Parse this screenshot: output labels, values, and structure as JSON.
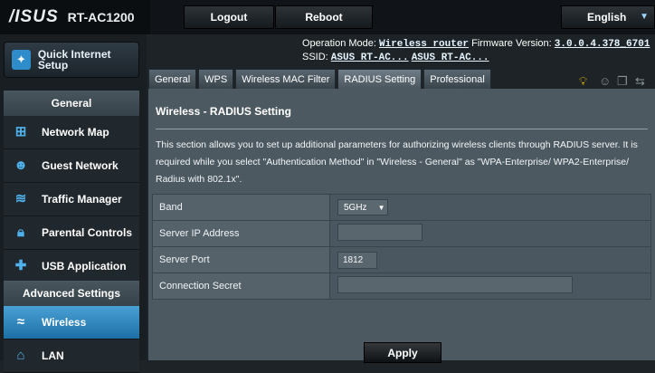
{
  "brand": {
    "logo": "/ISUS",
    "model": "RT-AC1200"
  },
  "header": {
    "logout": "Logout",
    "reboot": "Reboot",
    "language": "English"
  },
  "status": {
    "op_mode_label": "Operation Mode:",
    "op_mode_value": "Wireless router",
    "fw_label": "Firmware Version:",
    "fw_value": "3.0.0.4.378_6701",
    "ssid_label": "SSID:",
    "ssid_1": "ASUS RT-AC...",
    "ssid_2": "ASUS RT-AC..."
  },
  "sidebar": {
    "quick_setup": "Quick Internet Setup",
    "general_header": "General",
    "general_items": [
      {
        "label": "Network Map",
        "icon": "network-map-icon"
      },
      {
        "label": "Guest Network",
        "icon": "guest-network-icon"
      },
      {
        "label": "Traffic Manager",
        "icon": "traffic-manager-icon"
      },
      {
        "label": "Parental Controls",
        "icon": "parental-controls-icon"
      },
      {
        "label": "USB Application",
        "icon": "usb-application-icon"
      }
    ],
    "advanced_header": "Advanced Settings",
    "advanced_items": [
      {
        "label": "Wireless",
        "icon": "wireless-icon",
        "active": true
      },
      {
        "label": "LAN",
        "icon": "lan-icon"
      }
    ]
  },
  "tabs": [
    {
      "label": "General"
    },
    {
      "label": "WPS"
    },
    {
      "label": "Wireless MAC Filter"
    },
    {
      "label": "RADIUS Setting",
      "active": true
    },
    {
      "label": "Professional"
    }
  ],
  "panel": {
    "title": "Wireless - RADIUS Setting",
    "description": "This section allows you to set up additional parameters for authorizing wireless clients through RADIUS server. It is required while you select \"Authentication Method\" in \"Wireless - General\" as \"WPA-Enterprise/ WPA2-Enterprise/ Radius with 802.1x\".",
    "rows": [
      {
        "label": "Band",
        "type": "select",
        "value": "5GHz"
      },
      {
        "label": "Server IP Address",
        "type": "input",
        "value": ""
      },
      {
        "label": "Server Port",
        "type": "input",
        "value": "1812"
      },
      {
        "label": "Connection Secret",
        "type": "input",
        "value": ""
      }
    ],
    "apply": "Apply"
  },
  "colors": {
    "accent": "#2d8cc9",
    "panel": "#4d5961",
    "active_menu": "#3b8fc4"
  }
}
